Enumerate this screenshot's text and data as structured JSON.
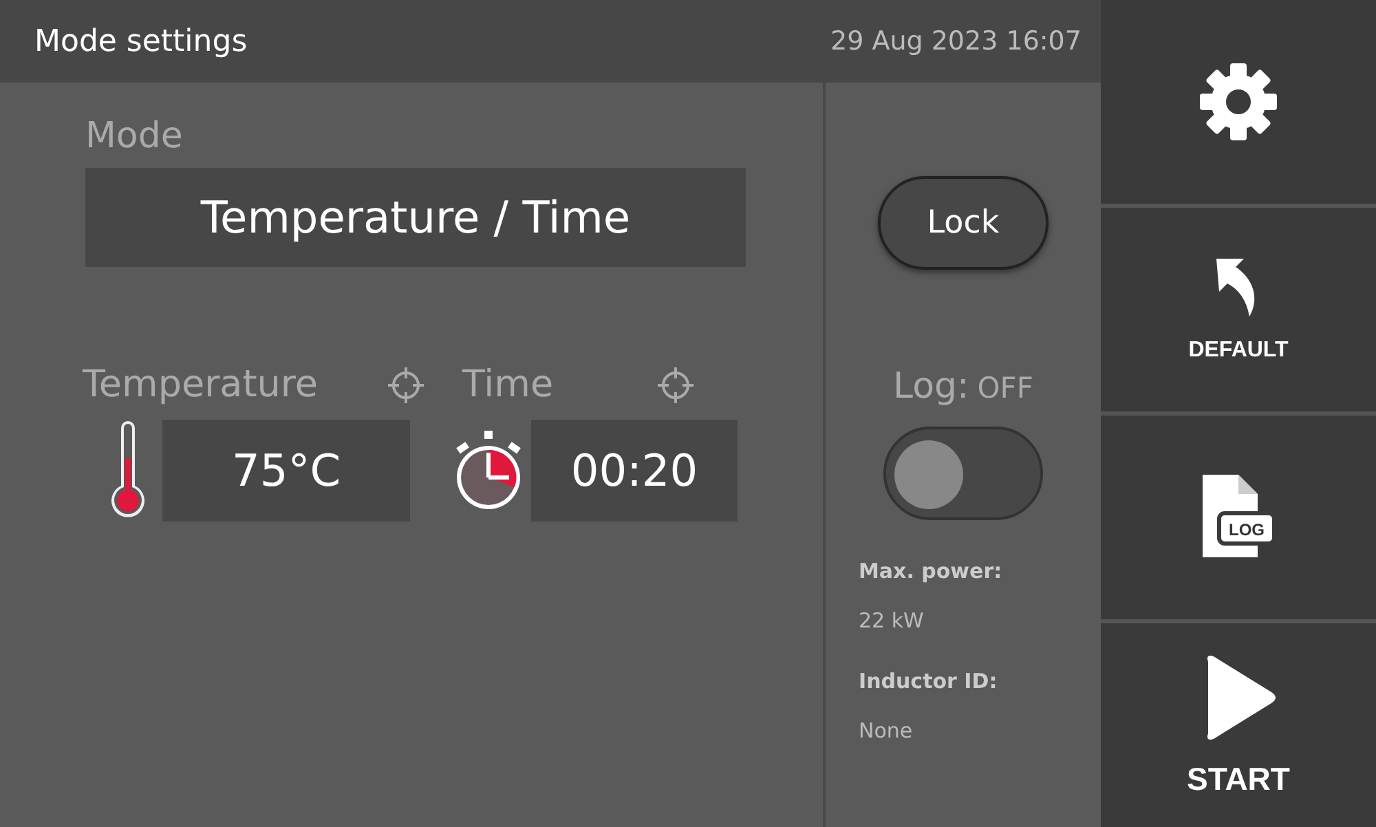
{
  "header": {
    "title": "Mode settings",
    "datetime": "29 Aug 2023 16:07"
  },
  "mode": {
    "label": "Mode",
    "value": "Temperature / Time"
  },
  "setpoints": [
    {
      "kind": "temperature",
      "label": "Temperature",
      "value": "75°C"
    },
    {
      "kind": "time",
      "label": "Time",
      "value": "00:20"
    }
  ],
  "lock_button": "Lock",
  "log": {
    "label": "Log:",
    "state_text": "OFF",
    "on": false
  },
  "info": [
    {
      "label": "Max. power:",
      "value": "22 kW"
    },
    {
      "label": "Inductor ID:",
      "value": "None"
    }
  ],
  "side_buttons": [
    {
      "kind": "settings"
    },
    {
      "kind": "default",
      "label": "DEFAULT"
    },
    {
      "kind": "log",
      "icon_text": "LOG"
    },
    {
      "kind": "start",
      "label": "START"
    }
  ]
}
